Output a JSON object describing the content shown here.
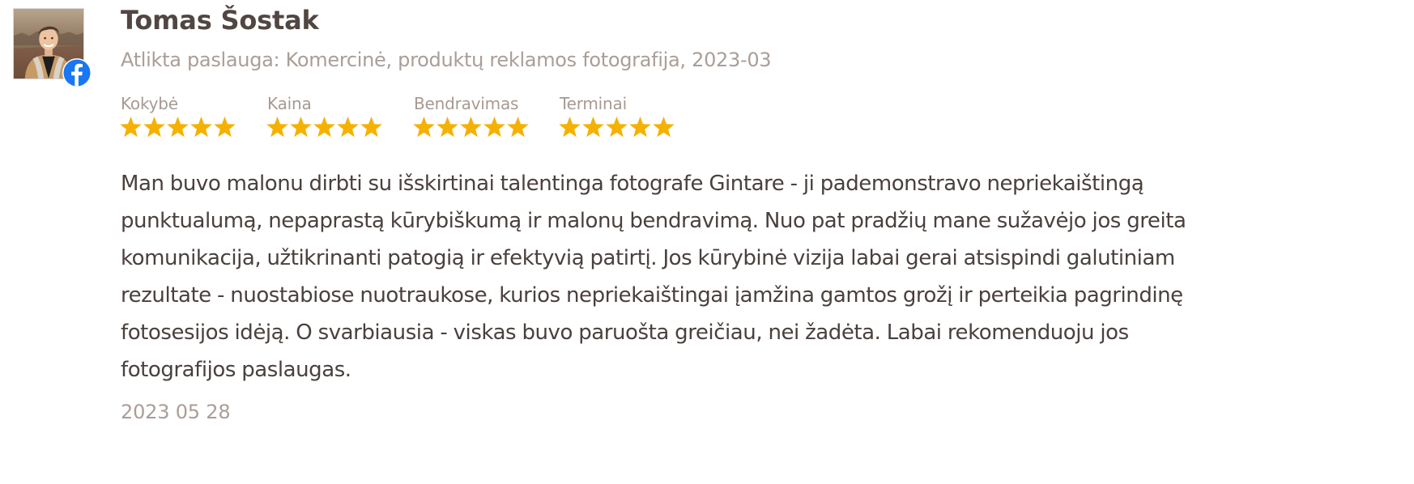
{
  "review": {
    "author": "Tomas Šostak",
    "service": "Atlikta paslauga: Komercinė, produktų reklamos fotografija, 2023-03",
    "ratings": [
      {
        "label": "Kokybė",
        "stars": 5,
        "max": 5
      },
      {
        "label": "Kaina",
        "stars": 5,
        "max": 5
      },
      {
        "label": "Bendravimas",
        "stars": 5,
        "max": 5
      },
      {
        "label": "Terminai",
        "stars": 5,
        "max": 5
      }
    ],
    "text": "Man buvo malonu dirbti su išskirtinai talentinga fotografe Gintare - ji pademonstravo nepriekaištingą punktualumą, nepaprastą kūrybiškumą ir malonų bendravimą. Nuo pat pradžių mane sužavėjo jos greita komunikacija, užtikrinanti patogią ir efektyvią patirtį. Jos kūrybinė vizija labai gerai atsispindi galutiniam rezultate - nuostabiose nuotraukose, kurios nepriekaištingai įamžina gamtos grožį ir perteikia pagrindinę fotosesijos idėją. O svarbiausia - viskas buvo paruošta greičiau, nei žadėta. Labai rekomenduoju jos fotografijos paslaugas.",
    "date": "2023 05 28"
  },
  "icons": {
    "avatar": "user-photo",
    "badge": "facebook-icon",
    "star": "star-icon"
  },
  "colors": {
    "star": "#f5b100",
    "facebook": "#1877f2",
    "name": "#514642",
    "muted": "#aa9e97",
    "body_text": "#4a403d"
  }
}
